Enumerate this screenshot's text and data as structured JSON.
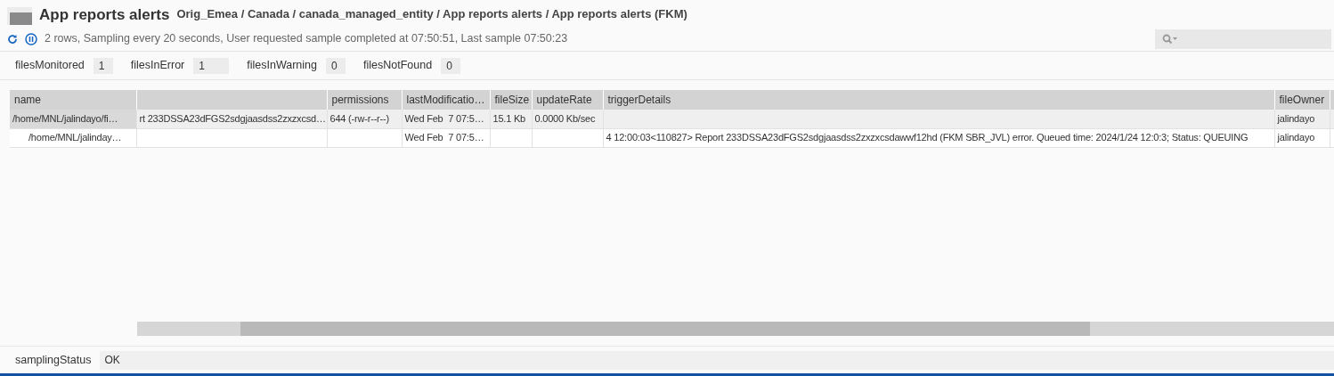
{
  "header": {
    "title": "App reports alerts",
    "breadcrumb": "Orig_Emea / Canada / canada_managed_entity / App reports alerts / App reports alerts (FKM)"
  },
  "status_line": "2 rows, Sampling every 20 seconds, User requested sample completed at 07:50:51, Last sample 07:50:23",
  "metrics": [
    {
      "label": "filesMonitored",
      "value": "1"
    },
    {
      "label": "filesInError",
      "value": "1"
    },
    {
      "label": "filesInWarning",
      "value": "0"
    },
    {
      "label": "filesNotFound",
      "value": "0"
    }
  ],
  "table": {
    "columns": [
      "name",
      "",
      "permissions",
      "lastModificatio…",
      "fileSize",
      "updateRate",
      "triggerDetails",
      "fileOwner"
    ],
    "rows": [
      {
        "selected": true,
        "cells": [
          "/home/MNL/jalindayo/fi…",
          "rt 233DSSA23dFGS2sdgjaasdss2zxzxcsd…",
          "644 (-rw-r--r--)",
          "Wed Feb  7 07:5…",
          "15.1 Kb",
          "0.0000 Kb/sec",
          "",
          "jalindayo"
        ],
        "children": [
          {
            "selected": false,
            "cells": [
              "/home/MNL/jalinday…",
              "",
              "",
              "Wed Feb  7 07:5…",
              "",
              "",
              "4 12:00:03<110827> Report 233DSSA23dFGS2sdgjaasdss2zxzxcsdawwf12hd (FKM SBR_JVL) error. Queued time: 2024/1/24 12:0:3; Status: QUEUING",
              "jalindayo"
            ]
          }
        ]
      }
    ]
  },
  "footer": {
    "label": "samplingStatus",
    "value": "OK"
  }
}
